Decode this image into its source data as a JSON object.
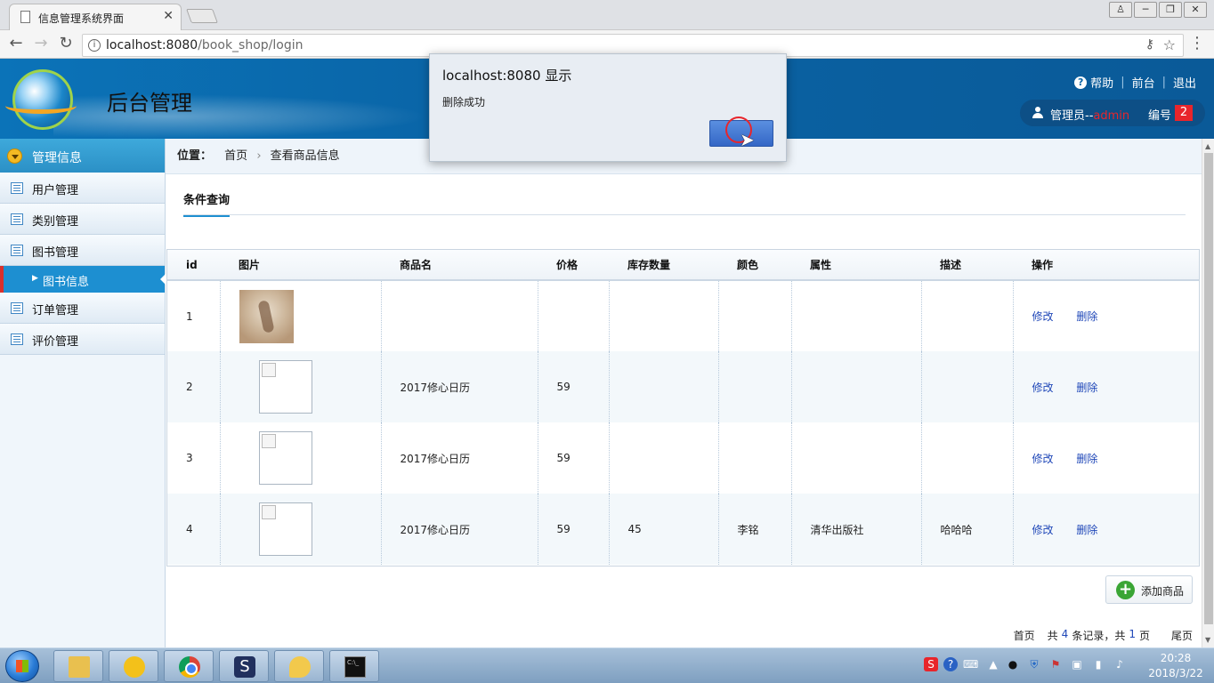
{
  "browser": {
    "tab_title": "信息管理系统界面",
    "tab_close": "✕",
    "url_host": "localhost:8080",
    "url_path": "/book_shop/login",
    "back": "←",
    "forward": "→",
    "reload": "↻",
    "win_min": "─",
    "win_restore": "❐",
    "win_close": "✕",
    "user_btn": "♙"
  },
  "header": {
    "title": "后台管理",
    "help": "帮助",
    "front": "前台",
    "logout": "退出",
    "user_prefix": "管理员--",
    "user_name": "admin",
    "id_label": "编号",
    "id_value": "2"
  },
  "sidebar": {
    "section": "管理信息",
    "items": [
      {
        "label": "用户管理"
      },
      {
        "label": "类别管理"
      },
      {
        "label": "图书管理"
      }
    ],
    "sub_item": "图书信息",
    "items_after": [
      {
        "label": "订单管理"
      },
      {
        "label": "评价管理"
      }
    ]
  },
  "main": {
    "place_label": "位置：",
    "crumbs": [
      "首页",
      "查看商品信息"
    ],
    "section_tab": "条件查询",
    "columns": [
      "id",
      "图片",
      "商品名",
      "价格",
      "库存数量",
      "颜色",
      "属性",
      "描述",
      "操作"
    ],
    "rows": [
      {
        "id": "1",
        "image": "photo",
        "name": "",
        "price": "",
        "stock": "",
        "color": "",
        "attr": "",
        "desc": "",
        "edit": "修改",
        "delete": "删除"
      },
      {
        "id": "2",
        "image": "broken",
        "name": "2017修心日历",
        "price": "59",
        "stock": "",
        "color": "",
        "attr": "",
        "desc": "",
        "edit": "修改",
        "delete": "删除"
      },
      {
        "id": "3",
        "image": "broken",
        "name": "2017修心日历",
        "price": "59",
        "stock": "",
        "color": "",
        "attr": "",
        "desc": "",
        "edit": "修改",
        "delete": "删除"
      },
      {
        "id": "4",
        "image": "broken",
        "name": "2017修心日历",
        "price": "59",
        "stock": "45",
        "color": "李铭",
        "attr": "清华出版社",
        "desc": "哈哈哈",
        "edit": "修改",
        "delete": "删除"
      }
    ],
    "add_button": "添加商品",
    "pager": {
      "first": "首页",
      "total_prefix": "共",
      "total_records": "4",
      "records_suffix": "条记录，共",
      "total_pages": "1",
      "pages_suffix": "页",
      "last": "尾页"
    }
  },
  "dialog": {
    "title": "localhost:8080 显示",
    "message": "删除成功",
    "ok_label": ""
  },
  "taskbar": {
    "time": "20:28",
    "date": "2018/3/22"
  }
}
